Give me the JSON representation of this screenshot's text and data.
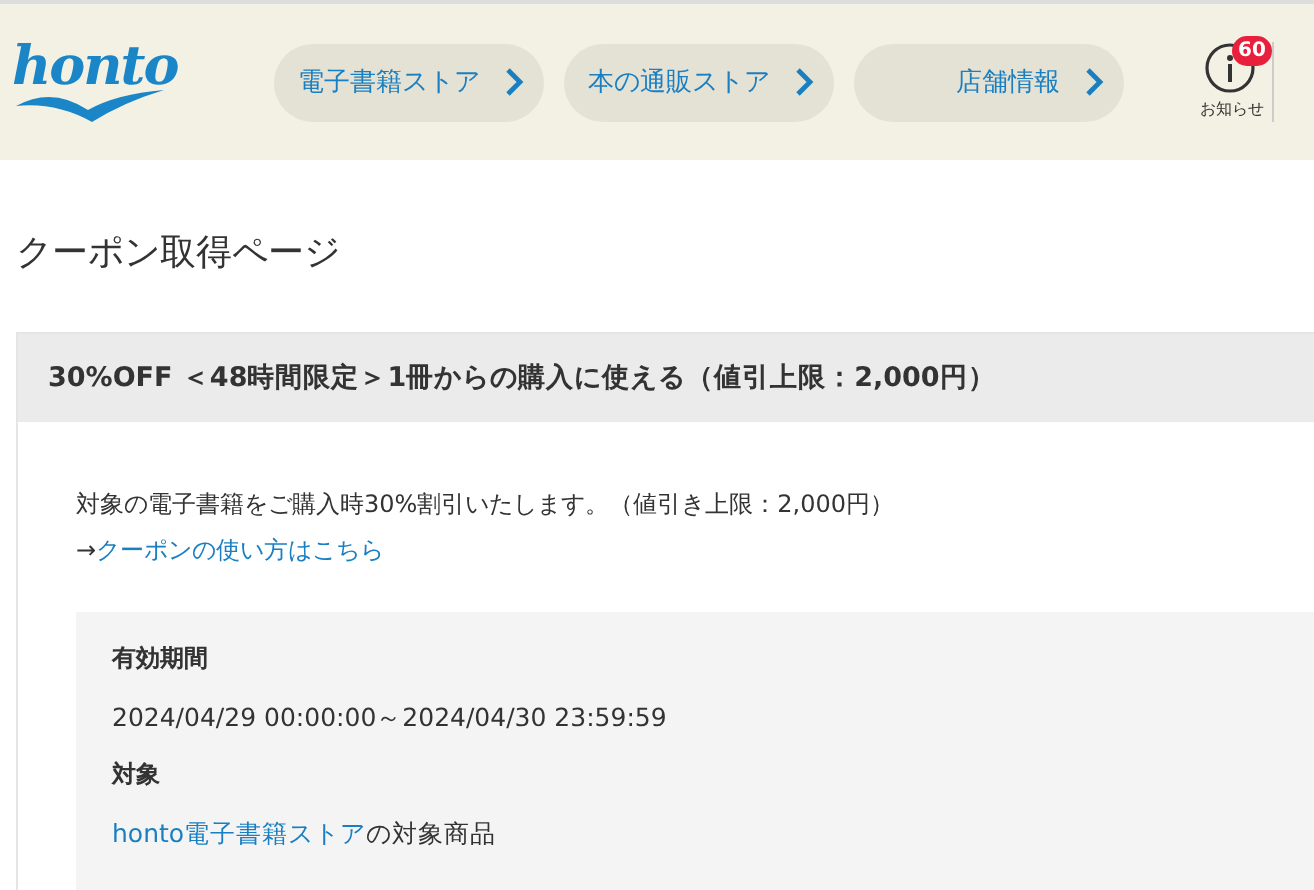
{
  "header": {
    "logo": "honto",
    "nav": [
      {
        "label": "電子書籍ストア"
      },
      {
        "label": "本の通販ストア"
      },
      {
        "label": "店舗情報"
      }
    ],
    "notice": {
      "badge": "60",
      "label": "お知らせ"
    }
  },
  "page_title": "クーポン取得ページ",
  "coupon": {
    "title": "30%OFF ＜48時間限定＞1冊からの購入に使える（値引上限：2,000円）",
    "description": "対象の電子書籍をご購入時30%割引いたします。（値引き上限：2,000円）",
    "howto": {
      "prefix": "→",
      "link": "クーポンの使い方はこちら"
    },
    "details": [
      {
        "heading": "有効期間",
        "text": "2024/04/29 00:00:00～2024/04/30 23:59:59"
      },
      {
        "heading": "対象",
        "link": "honto電子書籍ストア",
        "text": "の対象商品"
      }
    ]
  }
}
